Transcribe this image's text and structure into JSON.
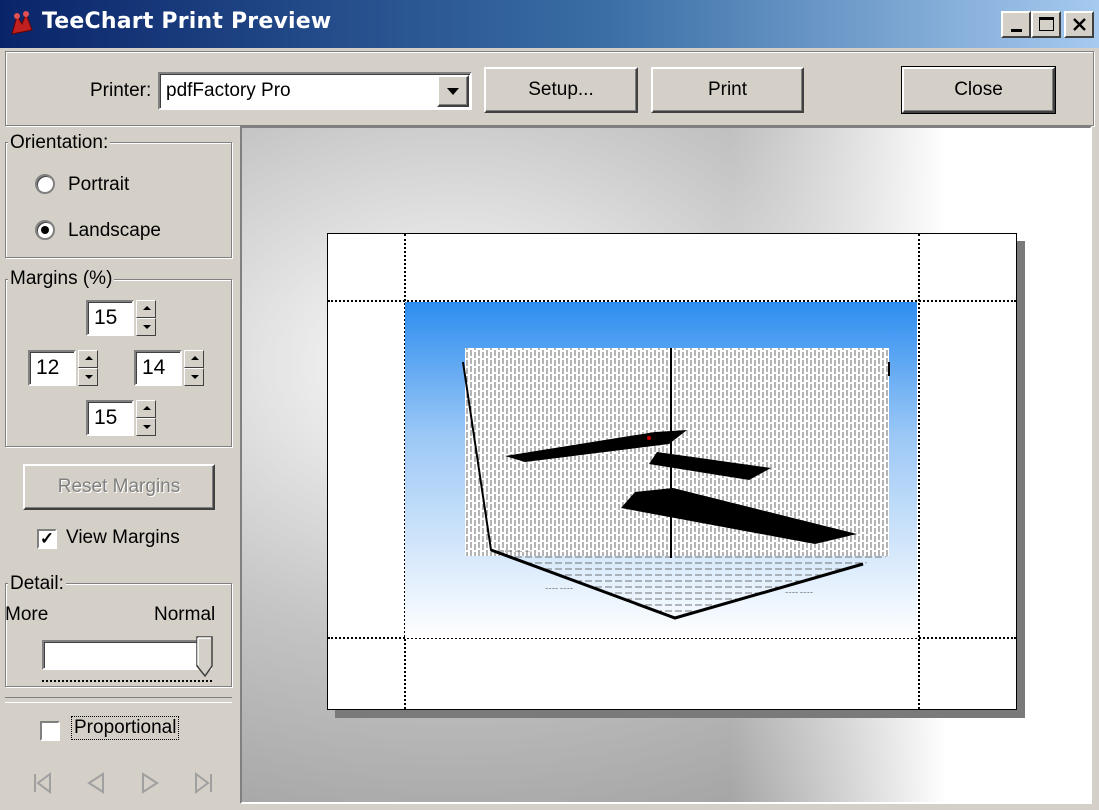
{
  "window": {
    "title": "TeeChart Print Preview",
    "controls": [
      "minimize",
      "maximize",
      "close"
    ]
  },
  "toolbar": {
    "printer_label": "Printer:",
    "printer_value": "pdfFactory Pro",
    "setup_label": "Setup...",
    "print_label": "Print",
    "close_label": "Close"
  },
  "orientation": {
    "label": "Orientation:",
    "options": [
      "Portrait",
      "Landscape"
    ],
    "selected": "Landscape"
  },
  "margins": {
    "label": "Margins (%)",
    "top": "15",
    "left": "12",
    "right": "14",
    "bottom": "15"
  },
  "reset_margins_label": "Reset Margins",
  "view_margins": {
    "label": "View Margins",
    "checked": true
  },
  "detail": {
    "label": "Detail:",
    "min_label": "More",
    "max_label": "Normal",
    "value": 1.0
  },
  "proportional": {
    "label": "Proportional",
    "checked": false
  },
  "nav": {
    "icons": [
      "first-page-icon",
      "previous-page-icon",
      "next-page-icon",
      "last-page-icon"
    ]
  },
  "colors": {
    "titlebar_start": "#0a246a",
    "titlebar_end": "#a6caf0",
    "face": "#d4d0c8",
    "chart_top": "#2d8df0"
  }
}
